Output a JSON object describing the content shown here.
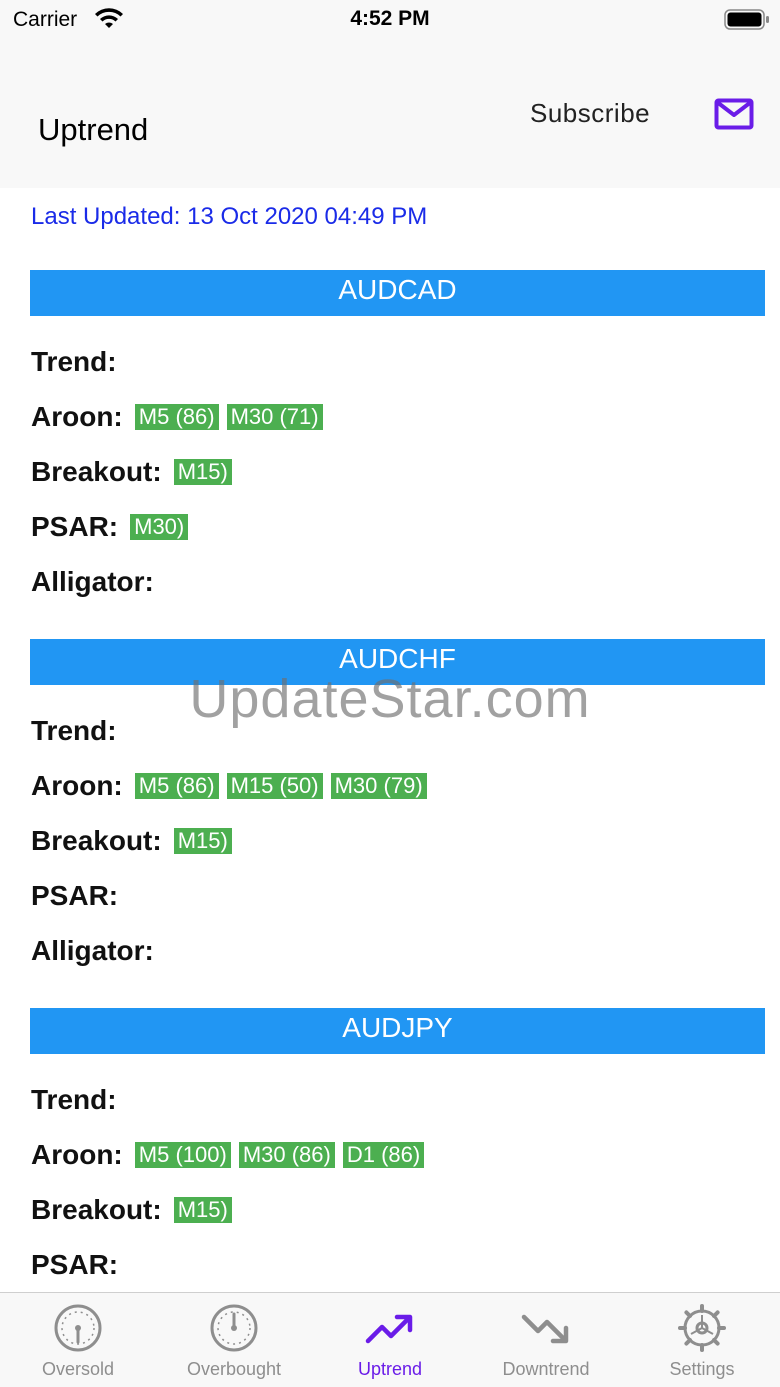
{
  "status_bar": {
    "carrier": "Carrier",
    "time": "4:52 PM"
  },
  "header": {
    "title": "Uptrend",
    "subscribe_label": "Subscribe"
  },
  "last_updated": "Last Updated: 13 Oct 2020 04:49 PM",
  "row_labels": {
    "trend": "Trend:",
    "aroon": "Aroon:",
    "breakout": "Breakout:",
    "psar": "PSAR:",
    "alligator": "Alligator:"
  },
  "pairs": [
    {
      "name": "AUDCAD",
      "aroon": [
        "M5 (86)",
        "M30 (71)"
      ],
      "breakout": [
        "M15)"
      ],
      "psar": [
        "M30)"
      ]
    },
    {
      "name": "AUDCHF",
      "aroon": [
        "M5 (86)",
        "M15 (50)",
        "M30 (79)"
      ],
      "breakout": [
        "M15)"
      ],
      "psar": []
    },
    {
      "name": "AUDJPY",
      "aroon": [
        "M5 (100)",
        "M30 (86)",
        "D1 (86)"
      ],
      "breakout": [
        "M15)"
      ],
      "psar": []
    }
  ],
  "watermark": "UpdateStar.com",
  "tabs": [
    {
      "label": "Oversold",
      "icon": "gauge-low-icon"
    },
    {
      "label": "Overbought",
      "icon": "gauge-high-icon"
    },
    {
      "label": "Uptrend",
      "icon": "trend-up-icon",
      "active": true
    },
    {
      "label": "Downtrend",
      "icon": "trend-down-icon"
    },
    {
      "label": "Settings",
      "icon": "gear-icon"
    }
  ],
  "colors": {
    "accent": "#6a1ce8",
    "header_blue": "#2196f3",
    "tag_green": "#4caf50",
    "link_blue": "#1a2be8"
  }
}
